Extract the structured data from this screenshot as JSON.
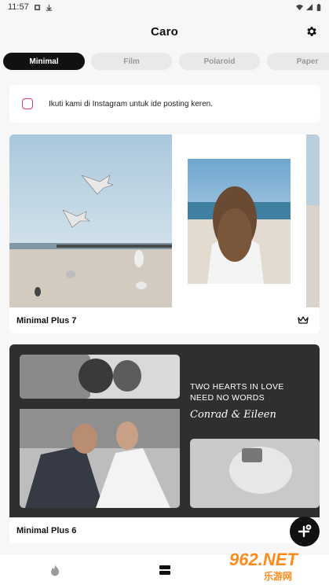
{
  "status_bar": {
    "time": "11:57",
    "icons": [
      "notification-icon",
      "download-icon",
      "wifi-icon",
      "signal-icon",
      "battery-icon"
    ]
  },
  "app_bar": {
    "title": "Caro",
    "settings_icon": "gear-icon"
  },
  "tabs": [
    {
      "label": "Minimal",
      "active": true
    },
    {
      "label": "Film",
      "active": false
    },
    {
      "label": "Polaroid",
      "active": false
    },
    {
      "label": "Paper",
      "active": false
    }
  ],
  "banner": {
    "icon": "instagram-icon",
    "text": "Ikuti kami di Instagram untuk ide posting keren."
  },
  "templates": [
    {
      "name": "Minimal Plus 7",
      "premium_icon": "crown-icon"
    },
    {
      "name": "Minimal Plus 6",
      "overlay": {
        "line1": "TWO HEARTS IN LOVE",
        "line2": "NEED NO WORDS",
        "script": "Conrad & Eileen"
      }
    }
  ],
  "fab": {
    "icon": "add-template-icon"
  },
  "bottom_nav": [
    {
      "icon": "flame-icon"
    },
    {
      "icon": "templates-icon"
    }
  ],
  "watermark": {
    "brand": "962.NET",
    "subtitle": "乐游网"
  },
  "colors": {
    "accent": "#111111",
    "tab_inactive": "#e9e9e9",
    "instagram": "#d63384"
  }
}
